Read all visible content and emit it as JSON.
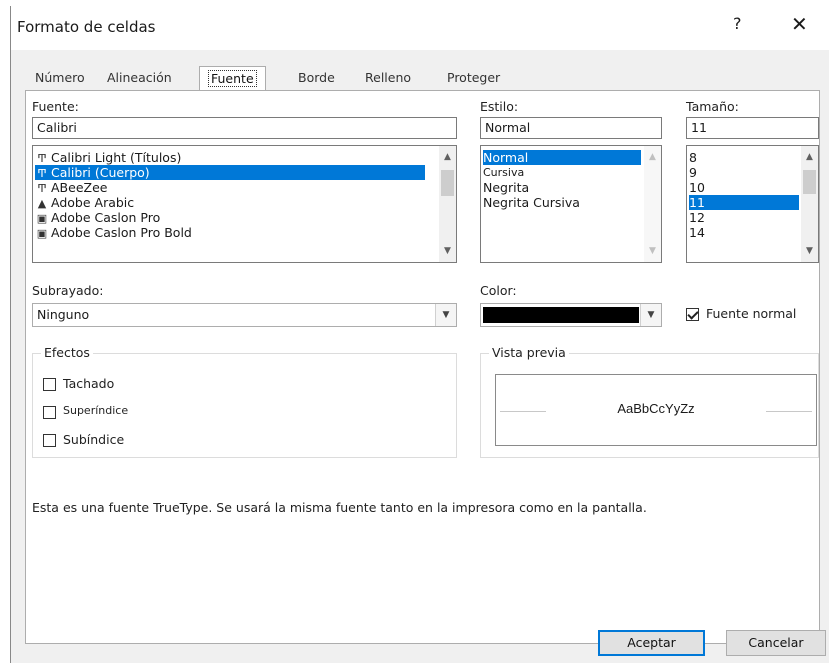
{
  "window": {
    "title": "Formato de celdas",
    "help": "?",
    "close": "✕"
  },
  "tabs": [
    "Número",
    "Alineación",
    "Fuente",
    "Borde",
    "Relleno",
    "Proteger"
  ],
  "font": {
    "label": "Fuente:",
    "value": "Calibri",
    "items": [
      {
        "icon": "Ͳ",
        "name": "Calibri Light (Títulos)"
      },
      {
        "icon": "Ͳ",
        "name": "Calibri (Cuerpo)"
      },
      {
        "icon": "Ͳ",
        "name": "ABeeZee"
      },
      {
        "icon": "▲",
        "name": "Adobe Arabic"
      },
      {
        "icon": "▣",
        "name": "Adobe Caslon Pro"
      },
      {
        "icon": "▣",
        "name": "Adobe Caslon Pro Bold"
      }
    ],
    "selected_index": 1
  },
  "style": {
    "label": "Estilo:",
    "value": "Normal",
    "items": [
      "Normal",
      "Cursiva",
      "Negrita",
      "Negrita Cursiva"
    ],
    "selected_index": 0
  },
  "size": {
    "label": "Tamaño:",
    "value": "11",
    "items": [
      "8",
      "9",
      "10",
      "11",
      "12",
      "14"
    ],
    "selected_index": 3
  },
  "underline": {
    "label": "Subrayado:",
    "value": "Ninguno"
  },
  "color": {
    "label": "Color:",
    "swatch": "#000000"
  },
  "normal_font": {
    "label": "Fuente normal",
    "checked": true
  },
  "effects": {
    "title": "Efectos",
    "items": [
      {
        "label": "Tachado",
        "checked": false
      },
      {
        "label": "Superíndice",
        "checked": false
      },
      {
        "label": "Subíndice",
        "checked": false
      }
    ]
  },
  "preview": {
    "title": "Vista previa",
    "sample": "AaBbCcYyZz"
  },
  "info": "Esta es una fuente TrueType. Se usará la misma fuente tanto en la impresora como en la pantalla.",
  "buttons": {
    "ok": "Aceptar",
    "cancel": "Cancelar"
  },
  "icons": {
    "scroll_up": "▲",
    "scroll_down": "▼",
    "dropdown": "▼"
  },
  "colors": {
    "selection": "#0078d7",
    "dialog_bg": "#f0f0f0",
    "panel_bg": "#ffffff"
  }
}
